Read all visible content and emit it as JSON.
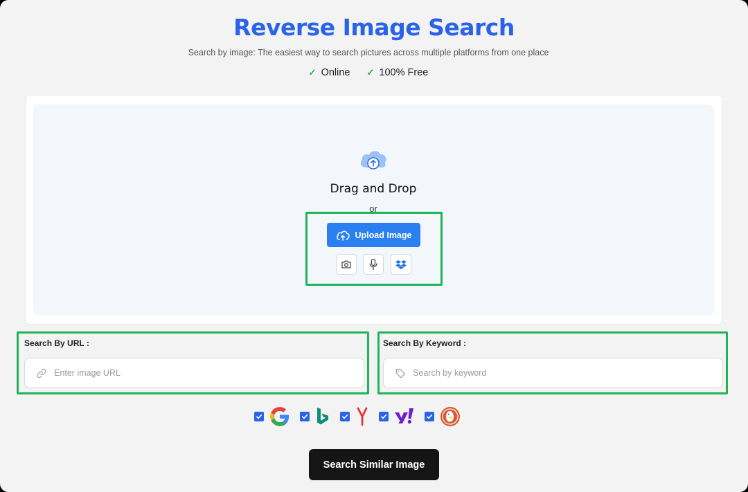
{
  "header": {
    "title": "Reverse Image Search",
    "subtitle": "Search by image: The easiest way to search pictures across multiple platforms from one place",
    "badges": [
      {
        "label": "Online",
        "icon": "check-icon"
      },
      {
        "label": "100% Free",
        "icon": "check-icon"
      }
    ]
  },
  "upload": {
    "cloud_icon": "cloud-upload-icon",
    "title": "Drag and Drop",
    "or_text": "or",
    "button_label": "Upload Image",
    "tools": [
      "camera-icon",
      "microphone-icon",
      "dropbox-icon"
    ]
  },
  "url_search": {
    "label": "Search By URL :",
    "placeholder": "Enter image URL",
    "value": "",
    "icon": "link-icon"
  },
  "keyword_search": {
    "label": "Search By Keyword :",
    "placeholder": "Search by keyword",
    "value": "",
    "icon": "tag-icon"
  },
  "engines": [
    {
      "name": "google-logo",
      "checked": true
    },
    {
      "name": "bing-logo",
      "checked": true
    },
    {
      "name": "yandex-logo",
      "checked": true
    },
    {
      "name": "yahoo-logo",
      "checked": true
    },
    {
      "name": "duckduckgo-logo",
      "checked": true
    }
  ],
  "search_button": {
    "label": "Search Similar Image"
  },
  "colors": {
    "title": "#2b63e8",
    "primary_button": "#2a80f0",
    "highlight": "#1fb35a",
    "check": "#22b24c",
    "search_button": "#151515"
  }
}
